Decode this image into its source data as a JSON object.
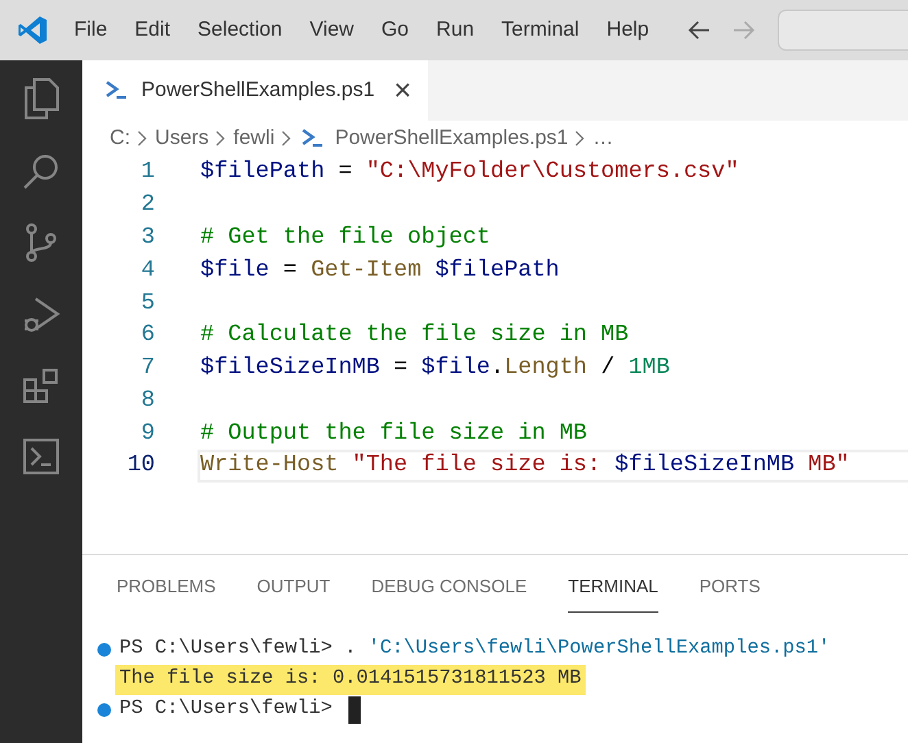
{
  "menu": [
    "File",
    "Edit",
    "Selection",
    "View",
    "Go",
    "Run",
    "Terminal",
    "Help"
  ],
  "tab": {
    "title": "PowerShellExamples.ps1",
    "close": "×",
    "selected": true
  },
  "breadcrumb": [
    {
      "kind": "folder",
      "text": "C:"
    },
    {
      "kind": "folder",
      "text": "Users"
    },
    {
      "kind": "folder",
      "text": "fewli"
    },
    {
      "kind": "file",
      "text": "PowerShellExamples.ps1"
    },
    {
      "kind": "more",
      "text": "…"
    }
  ],
  "editor": {
    "lines": [
      {
        "number": "1",
        "current": false,
        "tokens": [
          {
            "kind": "variable",
            "text": "$filePath"
          },
          {
            "kind": "operator",
            "text": " = "
          },
          {
            "kind": "string",
            "text": "\"C:\\MyFolder\\Customers.csv\""
          }
        ]
      },
      {
        "number": "2",
        "current": false
      },
      {
        "number": "3",
        "current": false,
        "tokens": [
          {
            "kind": "comment",
            "text": "# Get the file object"
          }
        ]
      },
      {
        "number": "4",
        "current": false,
        "tokens": [
          {
            "kind": "variable",
            "text": "$file"
          },
          {
            "kind": "operator",
            "text": " = "
          },
          {
            "kind": "command",
            "text": "Get-Item"
          },
          {
            "kind": "variable",
            "text": " $filePath"
          }
        ]
      },
      {
        "number": "5",
        "current": false
      },
      {
        "number": "6",
        "current": false,
        "tokens": [
          {
            "kind": "comment",
            "text": "# Calculate the file size in MB"
          }
        ]
      },
      {
        "number": "7",
        "current": false,
        "tokens": [
          {
            "kind": "variable",
            "text": "$fileSizeInMB"
          },
          {
            "kind": "operator",
            "text": " = "
          },
          {
            "kind": "variable",
            "text": "$file"
          },
          {
            "kind": "operator",
            "text": "."
          },
          {
            "kind": "property",
            "text": "Length"
          },
          {
            "kind": "operator",
            "text": " / "
          },
          {
            "kind": "number",
            "text": "1MB"
          }
        ]
      },
      {
        "number": "8",
        "current": false
      },
      {
        "number": "9",
        "current": false,
        "tokens": [
          {
            "kind": "comment",
            "text": "# Output the file size in MB"
          }
        ]
      },
      {
        "number": "10",
        "current": true,
        "tokens": [
          {
            "kind": "command",
            "text": "Write-Host"
          },
          {
            "kind": "string",
            "text": " \"The file size is: "
          },
          {
            "kind": "variable",
            "text": "$fileSizeInMB"
          },
          {
            "kind": "string",
            "text": " MB\""
          }
        ]
      }
    ]
  },
  "panel": {
    "tabs": [
      {
        "label": "PROBLEMS",
        "selected": false
      },
      {
        "label": "OUTPUT",
        "selected": false
      },
      {
        "label": "DEBUG CONSOLE",
        "selected": false
      },
      {
        "label": "TERMINAL",
        "selected": true
      },
      {
        "label": "PORTS",
        "selected": false
      }
    ],
    "terminal": [
      {
        "kind": "command",
        "highlighted": false,
        "cursor": false,
        "segments": [
          {
            "kind": "plain",
            "text": "PS C:\\Users\\fewli> . "
          },
          {
            "kind": "string",
            "text": "'C:\\Users\\fewli\\PowerShellExamples.ps1'"
          }
        ]
      },
      {
        "kind": "output",
        "highlighted": true,
        "cursor": false,
        "segments": [
          {
            "kind": "plain",
            "text": "The file size is: 0.0141515731811523 MB"
          }
        ]
      },
      {
        "kind": "command",
        "highlighted": false,
        "cursor": true,
        "segments": [
          {
            "kind": "plain",
            "text": "PS C:\\Users\\fewli> "
          }
        ]
      }
    ]
  }
}
